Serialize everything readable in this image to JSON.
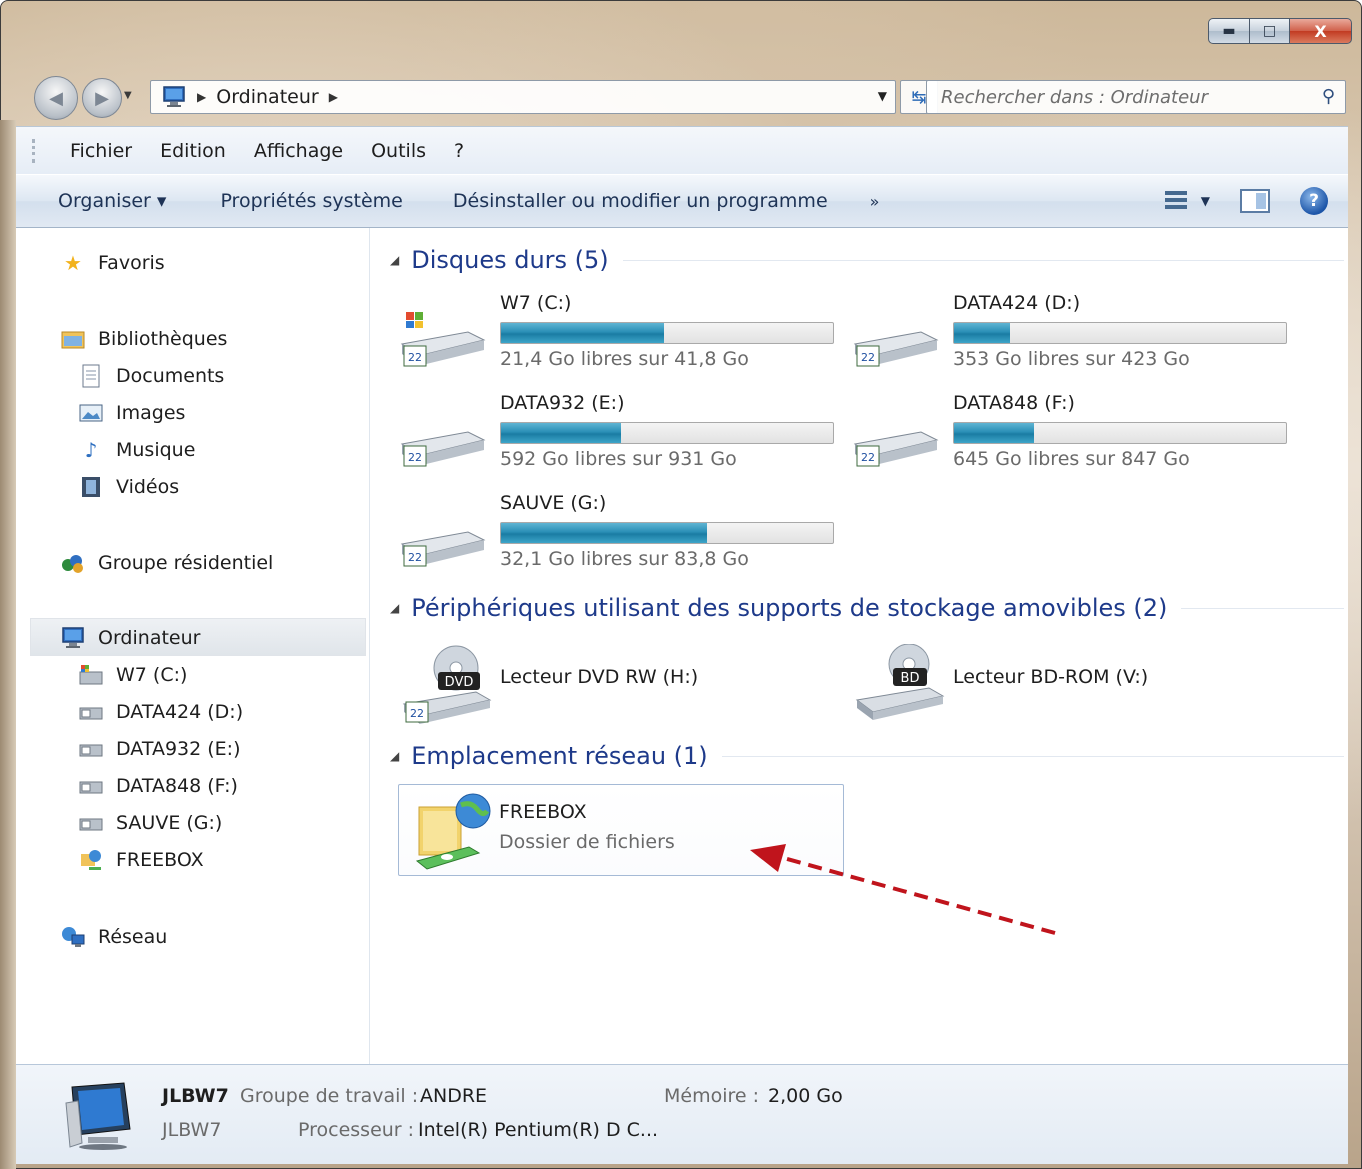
{
  "window": {
    "caption_buttons": {
      "minimize": "▬",
      "maximize": "□",
      "close": "X"
    }
  },
  "nav": {
    "address_path": "Ordinateur",
    "search_placeholder": "Rechercher dans : Ordinateur"
  },
  "menu": [
    "Fichier",
    "Edition",
    "Affichage",
    "Outils",
    "?"
  ],
  "command_bar": {
    "organiser": "Organiser ▾",
    "system_properties": "Propriétés système",
    "uninstall": "Désinstaller ou modifier un programme",
    "more": "»"
  },
  "sidebar": {
    "favorites": "Favoris",
    "libraries": "Bibliothèques",
    "library_items": [
      "Documents",
      "Images",
      "Musique",
      "Vidéos"
    ],
    "homegroup": "Groupe résidentiel",
    "computer": "Ordinateur",
    "computer_items": [
      "W7 (C:)",
      "DATA424 (D:)",
      "DATA932 (E:)",
      "DATA848 (F:)",
      "SAUVE (G:)",
      "FREEBOX"
    ],
    "network": "Réseau"
  },
  "groups": {
    "hard_disks": "Disques durs (5)",
    "removable": "Périphériques utilisant des supports de stockage amovibles (2)",
    "network": "Emplacement réseau (1)"
  },
  "drives": [
    {
      "name": "W7 (C:)",
      "free_text": "21,4 Go libres sur 41,8 Go",
      "used_fraction": 0.49
    },
    {
      "name": "DATA424 (D:)",
      "free_text": "353 Go libres sur 423 Go",
      "used_fraction": 0.17
    },
    {
      "name": "DATA932 (E:)",
      "free_text": "592 Go libres sur 931 Go",
      "used_fraction": 0.36
    },
    {
      "name": "DATA848 (F:)",
      "free_text": "645 Go libres sur 847 Go",
      "used_fraction": 0.24
    },
    {
      "name": "SAUVE (G:)",
      "free_text": "32,1 Go libres sur 83,8 Go",
      "used_fraction": 0.62
    }
  ],
  "removable_devices": [
    {
      "name": "Lecteur DVD RW (H:)",
      "badge": "DVD"
    },
    {
      "name": "Lecteur BD-ROM (V:)",
      "badge": "BD"
    }
  ],
  "network_location": {
    "name": "FREEBOX",
    "type": "Dossier de fichiers"
  },
  "details": {
    "computer_name": "JLBW7",
    "computer_subname": "JLBW7",
    "workgroup_label": "Groupe de travail :",
    "workgroup_value": "ANDRE",
    "memory_label": "Mémoire :",
    "memory_value": "2,00 Go",
    "processor_label": "Processeur :",
    "processor_value": "Intel(R) Pentium(R) D C..."
  },
  "colors": {
    "group_header": "#1e3a8a",
    "drive_fill": "#2a8fb6",
    "annotation_arrow": "#c0141c"
  },
  "drive_badge": "22"
}
